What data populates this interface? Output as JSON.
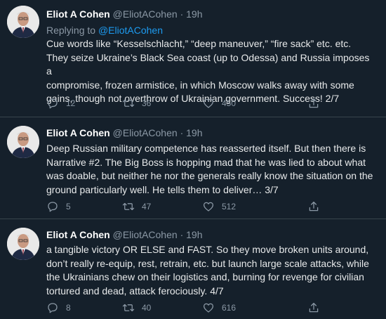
{
  "tweets": [
    {
      "name": "Eliot A Cohen",
      "handle": "@EliotACohen",
      "separator": "·",
      "time": "19h",
      "replying_prefix": "Replying to",
      "replying_handle": "@EliotACohen",
      "lines": [
        "Cue words like “Kesselschlacht,” “deep maneuver,” “fire sack” etc. etc.",
        "They seize Ukraine’s Black Sea coast (up to Odessa) and Russia imposes a",
        "compromise, frozen armistice, in which Moscow walks away with some",
        "gains, though not overthrow of Ukrainian government. Success! 2/7"
      ],
      "replies": "12",
      "retweets": "36",
      "likes": "450"
    },
    {
      "name": "Eliot A Cohen",
      "handle": "@EliotACohen",
      "separator": "·",
      "time": "19h",
      "lines": [
        "Deep Russian military competence has reasserted itself. But then there is",
        "Narrative #2. The Big Boss is hopping mad that he was lied to about what",
        "was doable, but neither he nor the generals really know the situation on the",
        "ground particularly well. He tells them to deliver… 3/7"
      ],
      "replies": "5",
      "retweets": "47",
      "likes": "512"
    },
    {
      "name": "Eliot A Cohen",
      "handle": "@EliotACohen",
      "separator": "·",
      "time": "19h",
      "lines": [
        "a tangible victory OR ELSE and FAST. So they move broken units around,",
        "don’t really re-equip, rest, retrain, etc. but launch large scale attacks, while",
        "the Ukrainians chew on their logistics and, burning for revenge for civilian",
        "tortured and dead, attack ferociously. 4/7"
      ],
      "replies": "8",
      "retweets": "40",
      "likes": "616"
    }
  ],
  "icons": {
    "reply": "reply-icon",
    "retweet": "retweet-icon",
    "like": "like-icon",
    "share": "share-icon"
  },
  "colors": {
    "background": "#15202b",
    "link": "#1d9bf0",
    "muted": "#8b98a5",
    "divider": "#38444d"
  }
}
